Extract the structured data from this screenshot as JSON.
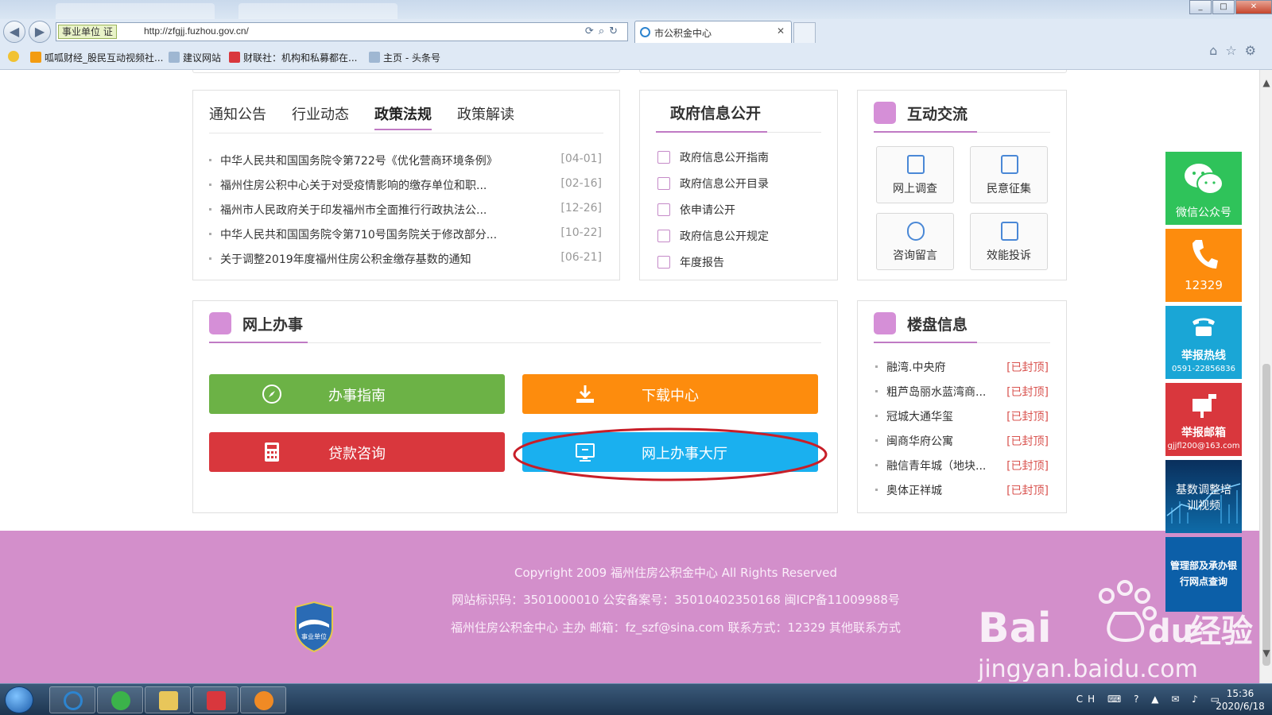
{
  "browser": {
    "address_badge": "事业单位 证",
    "url": "http://zfgjj.fuzhou.gov.cn/",
    "tab_title": "市公积金中心",
    "favorites": [
      "呱呱财经_股民互动视频社...",
      "建议网站",
      "财联社：机构和私募都在...",
      "主页 - 头条号"
    ]
  },
  "news": {
    "tabs": [
      "通知公告",
      "行业动态",
      "政策法规",
      "政策解读"
    ],
    "active_tab": "政策法规",
    "items": [
      {
        "title": "中华人民共和国国务院令第722号《优化营商环境条例》",
        "date": "[04-01]"
      },
      {
        "title": "福州住房公积中心关于对受疫情影响的缴存单位和职...",
        "date": "[02-16]"
      },
      {
        "title": "福州市人民政府关于印发福州市全面推行行政执法公...",
        "date": "[12-26]"
      },
      {
        "title": "中华人民共和国国务院令第710号国务院关于修改部分...",
        "date": "[10-22]"
      },
      {
        "title": "关于调整2019年度福州住房公积金缴存基数的通知",
        "date": "[06-21]"
      }
    ]
  },
  "gov_info": {
    "title": "政府信息公开",
    "items": [
      "政府信息公开指南",
      "政府信息公开目录",
      "依申请公开",
      "政府信息公开规定",
      "年度报告"
    ]
  },
  "interact": {
    "title": "互动交流",
    "buttons": [
      "网上调查",
      "民意征集",
      "咨询留言",
      "效能投诉"
    ]
  },
  "online": {
    "title": "网上办事",
    "buttons": [
      {
        "label": "办事指南",
        "color": "#6cb246"
      },
      {
        "label": "下载中心",
        "color": "#fd8c0d"
      },
      {
        "label": "贷款咨询",
        "color": "#d9373d"
      },
      {
        "label": "网上办事大厅",
        "color": "#1ab0ef"
      }
    ],
    "highlight_color": "#c81e28"
  },
  "property": {
    "title": "楼盘信息",
    "status": "[已封顶]",
    "items": [
      "融湾.中央府",
      "粗芦岛丽水蓝湾商...",
      "冠城大通华玺",
      "闽商华府公寓",
      "融信青年城（地块...",
      "奥体正祥城"
    ]
  },
  "footer": {
    "copyright": "Copyright 2009 福州住房公积金中心 All Rights Reserved",
    "line2": "网站标识码：3501000010 公安备案号：35010402350168  闽ICP备11009988号",
    "line3": "福州住房公积金中心 主办    邮箱：fz_szf@sina.com    联系方式：12329    其他联系方式",
    "badge": "事业单位"
  },
  "sidebar": {
    "wechat": "微信公众号",
    "phone": "12329",
    "hotline": "举报热线",
    "hotline_num": "0591-22856836",
    "mailbox": "举报邮箱",
    "mail": "gjjfl200@163.com",
    "video": "基数调整培训视频",
    "bank": "管理部及承办银行网点查询"
  },
  "watermark": {
    "brand": "Bai",
    "brand2": "du",
    "cn": "经验",
    "url": "jingyan.baidu.com"
  },
  "taskbar": {
    "tray": "CH",
    "time": "15:36",
    "date": "2020/6/18"
  },
  "colors": {
    "accent": "#c07ac4",
    "footer_bg": "#d38fcb",
    "wechat": "#2fc35a",
    "phone": "#fd8c0d",
    "hotline": "#1aa6d6",
    "mailbox": "#d9373d",
    "video": "#0b4f8a"
  }
}
